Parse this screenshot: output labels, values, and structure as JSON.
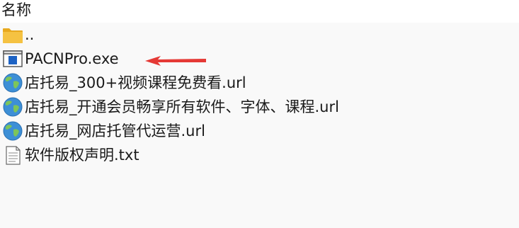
{
  "header": {
    "name_column": "名称"
  },
  "files": [
    {
      "name": "..",
      "icon": "folder-icon"
    },
    {
      "name": "PACNPro.exe",
      "icon": "exe-icon"
    },
    {
      "name": "店托易_300+视频课程免费看.url",
      "icon": "globe-icon"
    },
    {
      "name": "店托易_开通会员畅享所有软件、字体、课程.url",
      "icon": "globe-icon"
    },
    {
      "name": "店托易_网店托管代运营.url",
      "icon": "globe-icon"
    },
    {
      "name": "软件版权声明.txt",
      "icon": "text-file-icon"
    }
  ],
  "annotation": {
    "arrow_color": "#e53935",
    "points_to": "PACNPro.exe"
  },
  "colors": {
    "background": "#f9f9f9",
    "header_background": "#ffffff",
    "folder": "#f5c242",
    "text": "#1a1a1a"
  }
}
